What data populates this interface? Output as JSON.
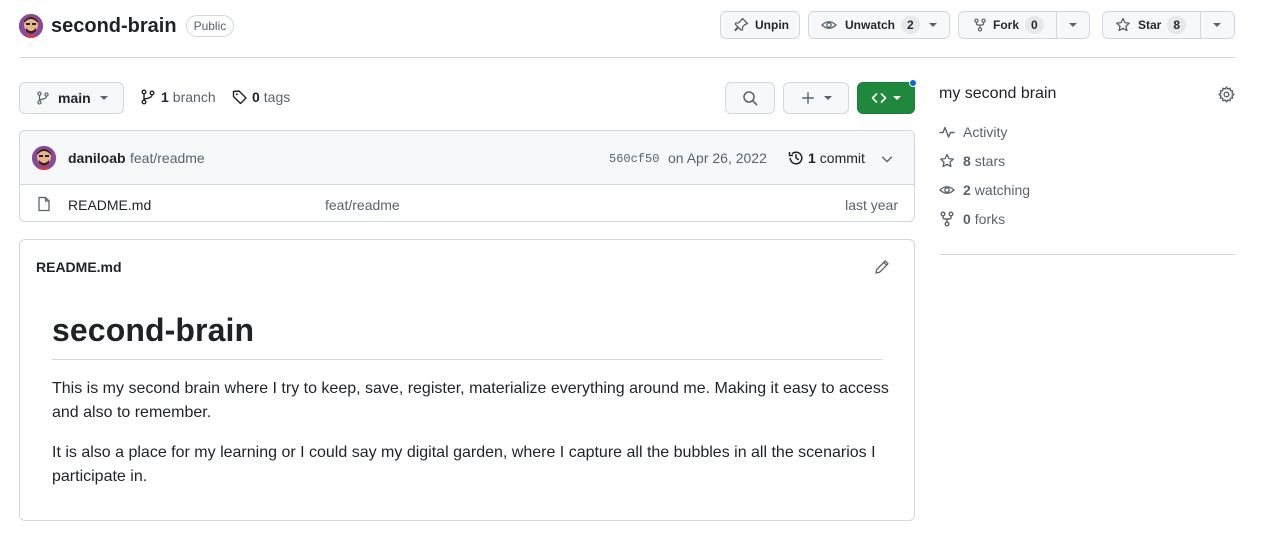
{
  "repo": {
    "name": "second-brain",
    "visibility": "Public"
  },
  "actions": {
    "unpin": "Unpin",
    "unwatch": "Unwatch",
    "watch_count": "2",
    "fork": "Fork",
    "fork_count": "0",
    "star": "Star",
    "star_count": "8"
  },
  "branch_bar": {
    "branch": "main",
    "branch_count": "1",
    "branch_label": "branch",
    "tag_count": "0",
    "tag_label": "tags"
  },
  "commit": {
    "author": "daniloab",
    "message": "feat/readme",
    "sha": "560cf50",
    "date": "on Apr 26, 2022",
    "count": "1",
    "count_label": "commit"
  },
  "files": [
    {
      "name": "README.md",
      "message": "feat/readme",
      "age": "last year"
    }
  ],
  "readme": {
    "filename": "README.md",
    "heading": "second-brain",
    "paragraphs": [
      "This is my second brain where I try to keep, save, register, materialize everything around me. Making it easy to access and also to remember.",
      "It is also a place for my learning or I could say my digital garden, where I capture all the bubbles in all the scenarios I participate in."
    ]
  },
  "about": {
    "description": "my second brain",
    "activity": "Activity",
    "stars_count": "8",
    "stars_label": "stars",
    "watching_count": "2",
    "watching_label": "watching",
    "forks_count": "0",
    "forks_label": "forks"
  },
  "colors": {
    "accent_green": "#1f883d",
    "notification_blue": "#0969da",
    "avatar_purple": "#7b3f8e"
  }
}
